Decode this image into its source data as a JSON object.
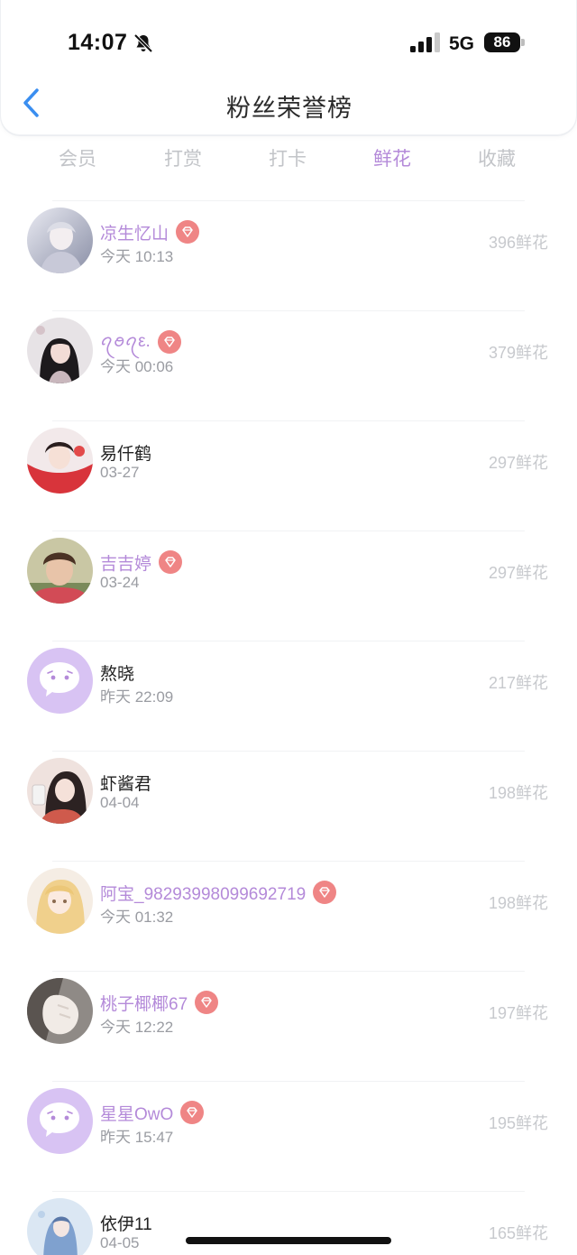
{
  "status": {
    "time": "14:07",
    "network": "5G",
    "battery": "86"
  },
  "header": {
    "title": "粉丝荣誉榜"
  },
  "tabs": [
    {
      "label": "会员",
      "active": false
    },
    {
      "label": "打赏",
      "active": false
    },
    {
      "label": "打卡",
      "active": false
    },
    {
      "label": "鲜花",
      "active": true
    },
    {
      "label": "收藏",
      "active": false
    }
  ],
  "colors": {
    "accent": "#b48ad9",
    "badge": "#ef8585",
    "muted": "#c7c9cd"
  },
  "fans": [
    {
      "name": "凉生忆山",
      "date": "今天 10:13",
      "count": "396鲜花",
      "vip": true,
      "avatar": "photo-avatar"
    },
    {
      "name": "ꪖꪮꪖ​ε.",
      "date": "今天 00:06",
      "count": "379鲜花",
      "vip": true,
      "avatar": "photo-avatar"
    },
    {
      "name": "易仟鹤",
      "date": "03-27",
      "count": "297鲜花",
      "vip": false,
      "avatar": "photo-avatar"
    },
    {
      "name": "吉吉婷",
      "date": "03-24",
      "count": "297鲜花",
      "vip": true,
      "avatar": "photo-avatar"
    },
    {
      "name": "熬晓",
      "date": "昨天 22:09",
      "count": "217鲜花",
      "vip": false,
      "avatar": "default-chat-avatar"
    },
    {
      "name": "虾酱君",
      "date": "04-04",
      "count": "198鲜花",
      "vip": false,
      "avatar": "photo-avatar"
    },
    {
      "name": "阿宝_98293998099692719",
      "date": "今天 01:32",
      "count": "198鲜花",
      "vip": true,
      "avatar": "photo-avatar"
    },
    {
      "name": "桃子椰椰67",
      "date": "今天 12:22",
      "count": "197鲜花",
      "vip": true,
      "avatar": "photo-avatar"
    },
    {
      "name": "星星OwO",
      "date": "昨天 15:47",
      "count": "195鲜花",
      "vip": true,
      "avatar": "default-chat-avatar"
    },
    {
      "name": "依伊11",
      "date": "04-05",
      "count": "165鲜花",
      "vip": false,
      "avatar": "photo-avatar"
    }
  ]
}
